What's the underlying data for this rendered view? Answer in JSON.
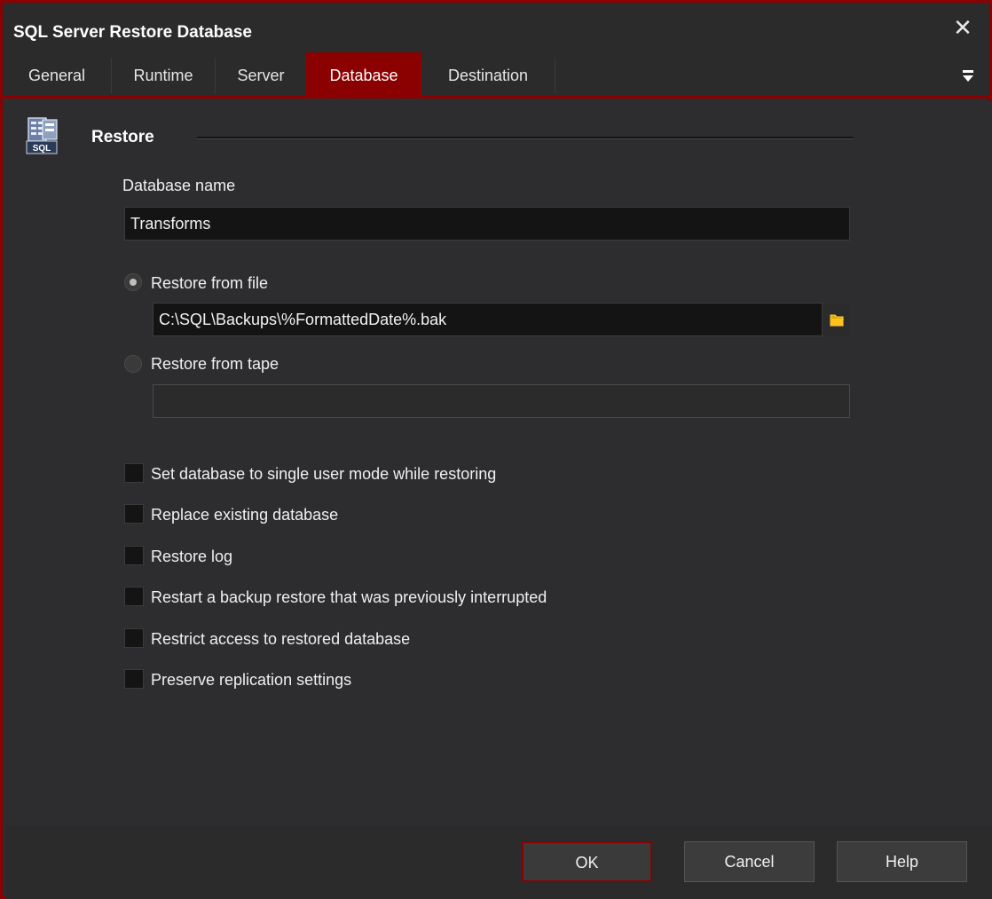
{
  "window": {
    "title": "SQL Server Restore Database",
    "accent_color": "#8b0000",
    "close_icon": "close-icon"
  },
  "tabs": [
    {
      "label": "General"
    },
    {
      "label": "Runtime"
    },
    {
      "label": "Server"
    },
    {
      "label": "Database"
    },
    {
      "label": "Destination"
    }
  ],
  "active_tab": "Database",
  "section": {
    "title": "Restore",
    "icon": "sql-database-icon"
  },
  "database_name": {
    "label": "Database name",
    "value": "Transforms"
  },
  "restore_from_file": {
    "label": "Restore from file",
    "selected": true,
    "path": "C:\\SQL\\Backups\\%FormattedDate%.bak",
    "browse_icon": "folder-icon"
  },
  "restore_from_tape": {
    "label": "Restore from tape",
    "selected": false,
    "value": ""
  },
  "options": [
    {
      "label": "Set database to single user mode while restoring",
      "checked": false
    },
    {
      "label": "Replace existing database",
      "checked": false
    },
    {
      "label": "Restore log",
      "checked": false
    },
    {
      "label": "Restart a backup restore that was previously interrupted",
      "checked": false
    },
    {
      "label": "Restrict access to restored database",
      "checked": false
    },
    {
      "label": "Preserve replication settings",
      "checked": false
    }
  ],
  "buttons": {
    "ok": "OK",
    "cancel": "Cancel",
    "help": "Help"
  }
}
